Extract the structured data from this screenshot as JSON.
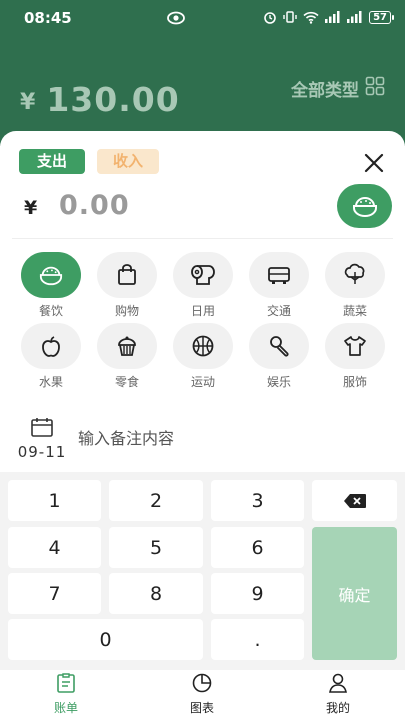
{
  "status_bar": {
    "time": "08:45",
    "battery": "57"
  },
  "header": {
    "currency": "¥",
    "total": "130.00",
    "type_filter": "全部类型"
  },
  "entry": {
    "tab_expense": "支出",
    "tab_income": "收入",
    "currency": "¥",
    "amount": "0.00"
  },
  "categories": [
    {
      "label": "餐饮",
      "icon": "rice-bowl-icon",
      "selected": true
    },
    {
      "label": "购物",
      "icon": "shopping-bag-icon"
    },
    {
      "label": "日用",
      "icon": "tissue-roll-icon"
    },
    {
      "label": "交通",
      "icon": "bus-icon"
    },
    {
      "label": "蔬菜",
      "icon": "vegetable-icon"
    },
    {
      "label": "水果",
      "icon": "apple-icon"
    },
    {
      "label": "零食",
      "icon": "cupcake-icon"
    },
    {
      "label": "运动",
      "icon": "basketball-icon"
    },
    {
      "label": "娱乐",
      "icon": "microphone-icon"
    },
    {
      "label": "服饰",
      "icon": "shirt-icon"
    }
  ],
  "note": {
    "date": "09-11",
    "placeholder": "输入备注内容"
  },
  "keypad": {
    "keys": [
      "1",
      "2",
      "3",
      "4",
      "5",
      "6",
      "7",
      "8",
      "9",
      "0",
      "."
    ],
    "backspace_icon": "backspace-icon",
    "confirm": "确定"
  },
  "tabbar": [
    {
      "label": "账单",
      "icon": "bill-icon",
      "active": true
    },
    {
      "label": "图表",
      "icon": "pie-chart-icon"
    },
    {
      "label": "我的",
      "icon": "user-icon"
    }
  ],
  "colors": {
    "primary": "#2f6f4e",
    "accent": "#3e9d63",
    "confirm": "#a6d4b6",
    "income": "#f2b36f"
  }
}
